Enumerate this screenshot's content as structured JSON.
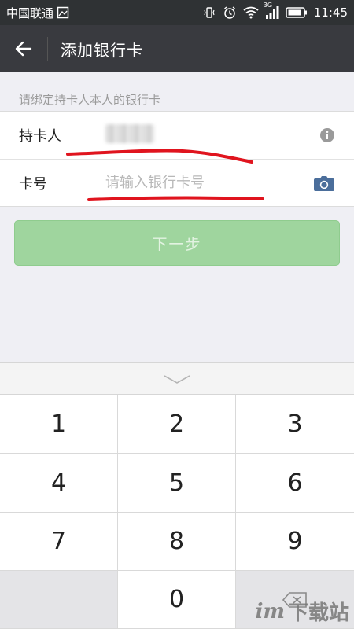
{
  "status_bar": {
    "carrier": "中国联通",
    "network": "3G",
    "time": "11:45"
  },
  "nav": {
    "title": "添加银行卡"
  },
  "form": {
    "hint": "请绑定持卡人本人的银行卡",
    "holder_label": "持卡人",
    "card_label": "卡号",
    "card_placeholder": "请输入银行卡号"
  },
  "next_button": "下一步",
  "keyboard": {
    "keys": [
      "1",
      "2",
      "3",
      "4",
      "5",
      "6",
      "7",
      "8",
      "9",
      "",
      "0",
      ""
    ]
  },
  "watermark": {
    "logo": "im",
    "text": "下载站"
  },
  "colors": {
    "status_bar": "#2f3234",
    "nav_bar": "#393a3f",
    "primary_disabled": "#9fd59e",
    "annotation": "#e0141e",
    "camera_icon": "#4b6e9b"
  }
}
